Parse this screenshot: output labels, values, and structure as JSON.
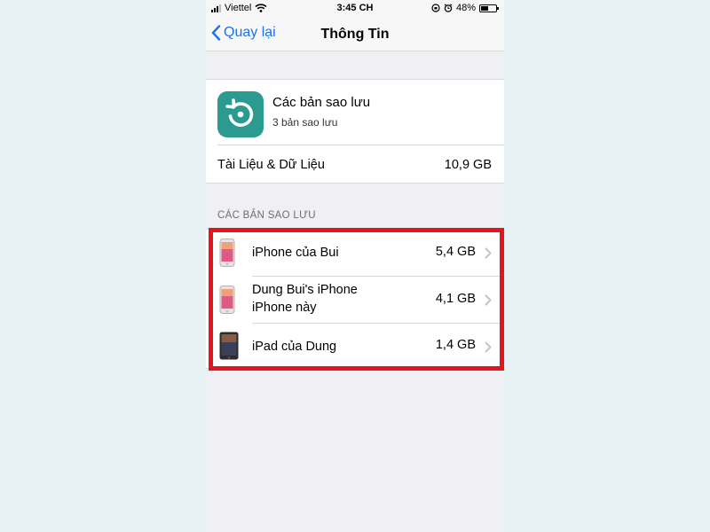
{
  "status_bar": {
    "carrier": "Viettel",
    "time": "3:45 CH",
    "battery": "48%",
    "battery_level": 0.48
  },
  "nav": {
    "back_label": "Quay lại",
    "title": "Thông Tin"
  },
  "backup_summary": {
    "title": "Các bản sao lưu",
    "subtitle": "3 bản sao lưu",
    "icon": "restore-icon",
    "icon_color": "#2b9b92"
  },
  "docs": {
    "label": "Tài Liệu & Dữ Liệu",
    "value": "10,9 GB"
  },
  "section_header": "CÁC BẢN SAO LƯU",
  "backups": [
    {
      "name": "iPhone của Bui",
      "size": "5,4 GB",
      "device": "iphone-icon"
    },
    {
      "name": "Dung Bui's iPhone",
      "name_line2": "iPhone này",
      "size": "4,1 GB",
      "device": "iphone-icon"
    },
    {
      "name": "iPad của Dung",
      "size": "1,4 GB",
      "device": "ipad-icon"
    }
  ],
  "colors": {
    "accent": "#1a73e8",
    "highlight": "#e3161d",
    "background": "#e8f2f4"
  }
}
